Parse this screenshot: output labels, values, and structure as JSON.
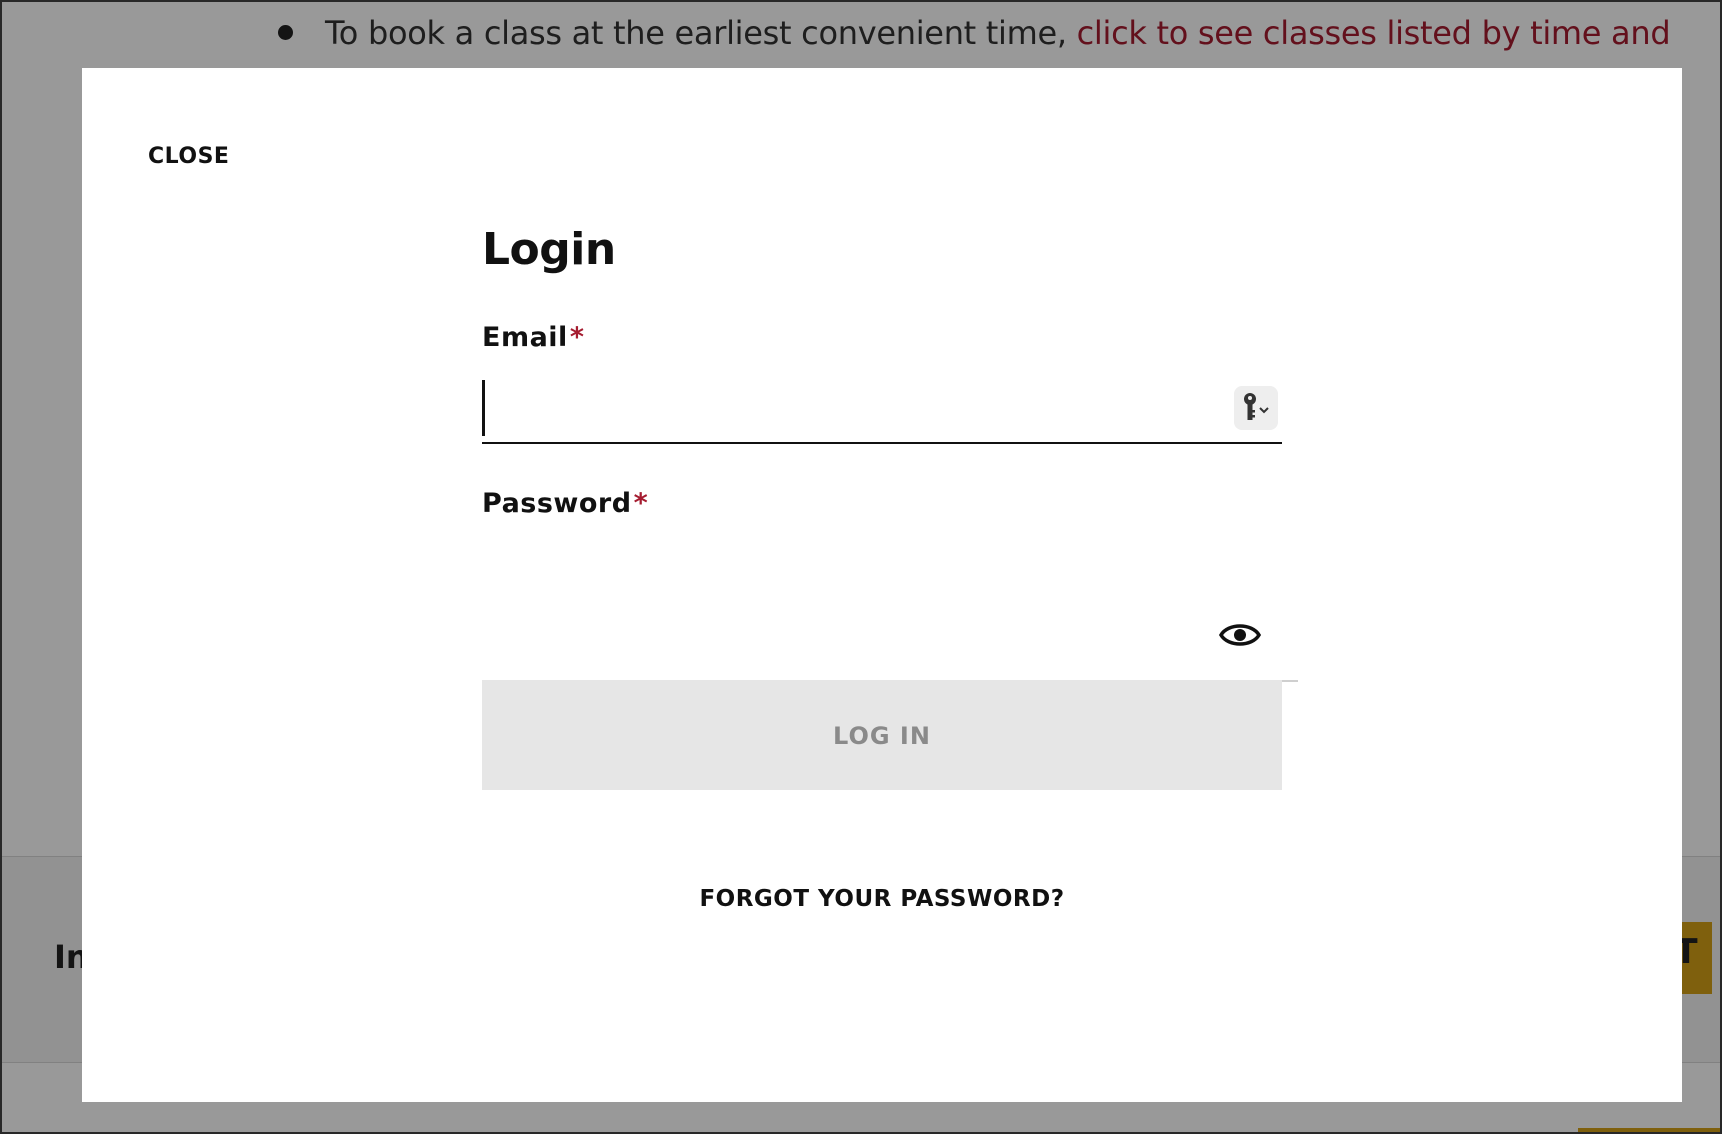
{
  "background": {
    "bullet_text": "To book a class at the earliest convenient time, ",
    "bullet_link": "click to see classes listed by time and",
    "band_text": "In",
    "gold_button_glyph": "T"
  },
  "modal": {
    "close_label": "CLOSE",
    "title": "Login",
    "email": {
      "label": "Email",
      "required_mark": "*",
      "value": "",
      "placeholder": "",
      "autofill_icon": "key-icon"
    },
    "password": {
      "label": "Password",
      "required_mark": "*",
      "value": "",
      "placeholder": "",
      "toggle_icon": "eye-icon"
    },
    "login_button_label": "LOG IN",
    "forgot_password_label": "FORGOT YOUR PASSWORD?"
  },
  "colors": {
    "accent_red": "#a51c30",
    "gold": "#d4a017",
    "button_disabled_bg": "#e6e6e6",
    "button_disabled_text": "#8a8a8a"
  }
}
